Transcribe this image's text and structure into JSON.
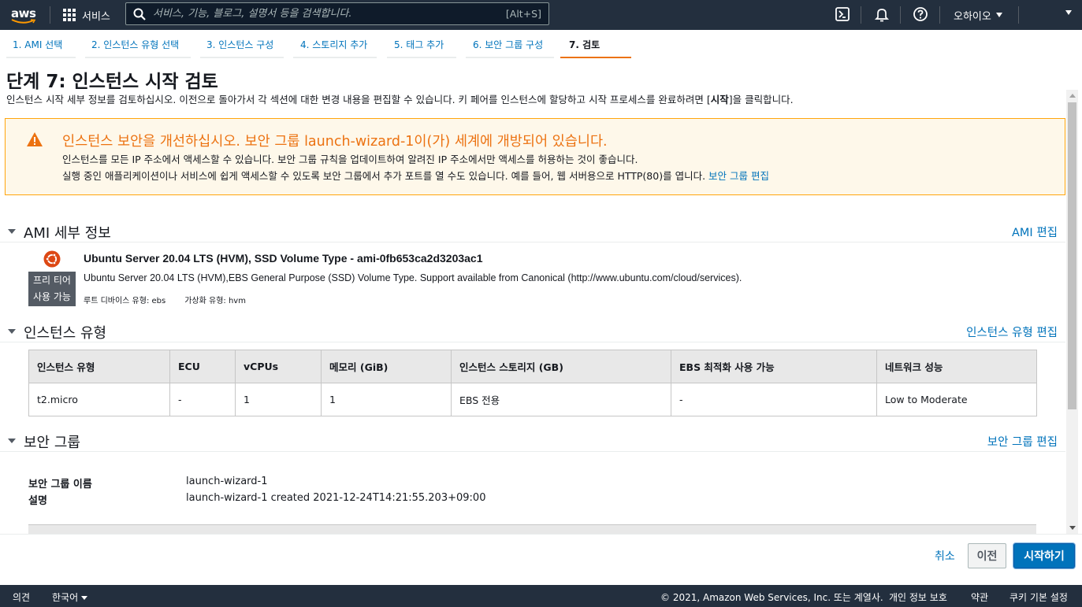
{
  "topnav": {
    "logo_text": "aws",
    "services_label": "서비스",
    "search_placeholder": "서비스, 기능, 블로그, 설명서 등을 검색합니다.",
    "search_shortcut": "[Alt+S]",
    "region": "오하이오"
  },
  "wizard_tabs": [
    {
      "label": "1. AMI 선택"
    },
    {
      "label": "2. 인스턴스 유형 선택"
    },
    {
      "label": "3. 인스턴스 구성"
    },
    {
      "label": "4. 스토리지 추가"
    },
    {
      "label": "5. 태그 추가"
    },
    {
      "label": "6. 보안 그룹 구성"
    },
    {
      "label": "7. 검토",
      "active": true
    }
  ],
  "header": {
    "title": "단계 7: 인스턴스 시작 검토",
    "desc_before": "인스턴스 시작 세부 정보를 검토하십시오. 이전으로 돌아가서 각 섹션에 대한 변경 내용을 편집할 수 있습니다. 키 페어를 인스턴스에 할당하고 시작 프로세스를 완료하려면 [",
    "desc_bold": "시작",
    "desc_after": "]을 클릭합니다."
  },
  "warning": {
    "title": "인스턴스 보안을 개선하십시오. 보안 그룹 launch-wizard-1이(가) 세계에 개방되어 있습니다.",
    "line1": "인스턴스를 모든 IP 주소에서 액세스할 수 있습니다. 보안 그룹 규칙을 업데이트하여 알려진 IP 주소에서만 액세스를 허용하는 것이 좋습니다.",
    "line2": "실행 중인 애플리케이션이나 서비스에 쉽게 액세스할 수 있도록 보안 그룹에서 추가 포트를 열 수도 있습니다. 예를 들어, 웹 서버용으로 HTTP(80)를 엽니다.",
    "link": "보안 그룹 편집",
    "accent_color": "#ec7211"
  },
  "ami": {
    "section_title": "AMI 세부 정보",
    "edit_link": "AMI 편집",
    "name": "Ubuntu Server 20.04 LTS (HVM), SSD Volume Type - ami-0fb653ca2d3203ac1",
    "description": "Ubuntu Server 20.04 LTS (HVM),EBS General Purpose (SSD) Volume Type. Support available from Canonical (http://www.ubuntu.com/cloud/services).",
    "root_device": "루트 디바이스 유형: ebs",
    "virtualization": "가상화 유형: hvm",
    "badge_line1": "프리 티어",
    "badge_line2": "사용 가능"
  },
  "instance_type": {
    "section_title": "인스턴스 유형",
    "edit_link": "인스턴스 유형 편집",
    "columns": [
      "인스턴스 유형",
      "ECU",
      "vCPUs",
      "메모리 (GiB)",
      "인스턴스 스토리지 (GB)",
      "EBS 최적화 사용 가능",
      "네트워크 성능"
    ],
    "rows": [
      [
        "t2.micro",
        "-",
        "1",
        "1",
        "EBS 전용",
        "-",
        "Low to Moderate"
      ]
    ]
  },
  "security_group": {
    "section_title": "보안 그룹",
    "edit_link": "보안 그룹 편집",
    "name_label": "보안 그룹 이름",
    "name_value": "launch-wizard-1",
    "desc_label": "설명",
    "desc_value": "launch-wizard-1 created 2021-12-24T14:21:55.203+09:00"
  },
  "actions": {
    "cancel": "취소",
    "previous": "이전",
    "launch": "시작하기"
  },
  "footer": {
    "feedback": "의견",
    "language": "한국어",
    "copyright": "© 2021, Amazon Web Services, Inc. 또는 계열사.",
    "privacy": "개인 정보 보호",
    "terms": "약관",
    "cookies": "쿠키 기본 설정"
  }
}
